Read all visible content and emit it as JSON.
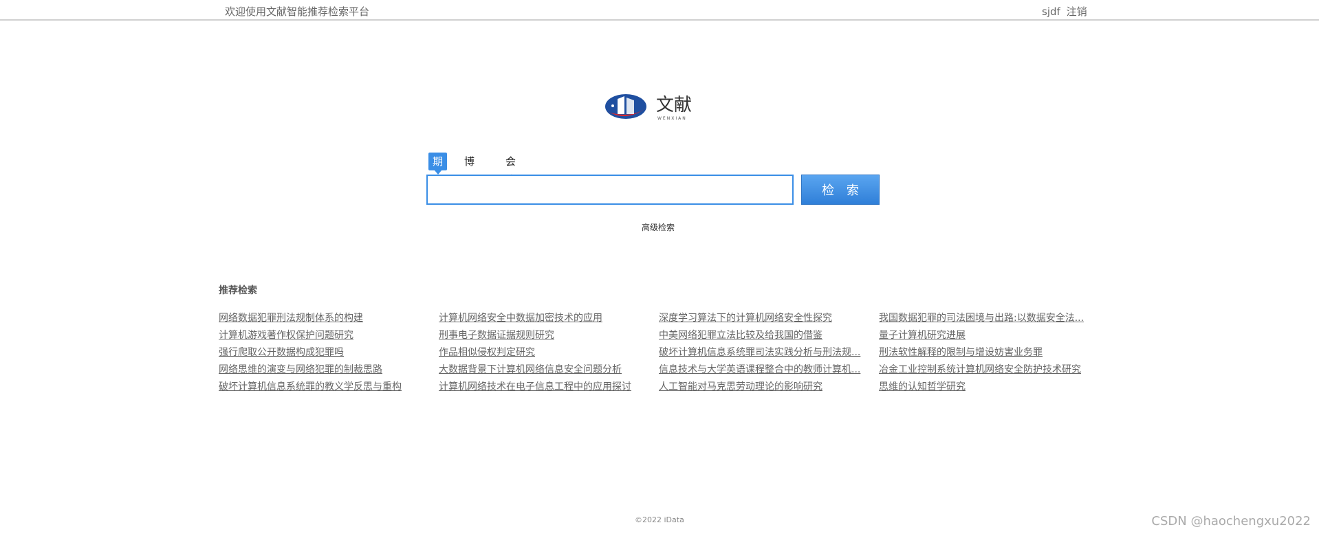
{
  "topbar": {
    "welcome": "欢迎使用文献智能推荐检索平台",
    "username": "sjdf",
    "logout": "注销"
  },
  "logo": {
    "title": "文献",
    "subtitle": "WENXIAN",
    "colors": {
      "blue": "#1f4fa0",
      "red": "#d8282f"
    }
  },
  "search": {
    "tabs": [
      {
        "label": "期刊",
        "active": true
      },
      {
        "label": "博硕士",
        "active": false
      },
      {
        "label": "会议",
        "active": false
      }
    ],
    "value": "",
    "placeholder": "",
    "button_label": "检 索",
    "advanced_label": "高级检索"
  },
  "recommend": {
    "title": "推荐检索",
    "columns": [
      [
        "网络数据犯罪刑法规制体系的构建",
        "计算机游戏著作权保护问题研究",
        "强行爬取公开数据构成犯罪吗",
        "网络思维的演变与网络犯罪的制裁思路",
        "破坏计算机信息系统罪的教义学反思与重构"
      ],
      [
        "计算机网络安全中数据加密技术的应用",
        "刑事电子数据证据规则研究",
        "作品相似侵权判定研究",
        "大数据背景下计算机网络信息安全问题分析",
        "计算机网络技术在电子信息工程中的应用探讨"
      ],
      [
        "深度学习算法下的计算机网络安全性探究",
        "中美网络犯罪立法比较及给我国的借鉴",
        "破坏计算机信息系统罪司法实践分析与刑法规...",
        "信息技术与大学英语课程整合中的教师计算机...",
        "人工智能对马克思劳动理论的影响研究"
      ],
      [
        "我国数据犯罪的司法困境与出路:以数据安全法...",
        "量子计算机研究进展",
        "刑法软性解释的限制与增设妨害业务罪",
        "冶金工业控制系统计算机网络安全防护技术研究",
        "思维的认知哲学研究"
      ]
    ]
  },
  "footer": {
    "copyright": "©2022 iData"
  },
  "watermark": "CSDN @haochengxu2022",
  "colors": {
    "accent": "#3a8ee6",
    "link": "#666666"
  }
}
